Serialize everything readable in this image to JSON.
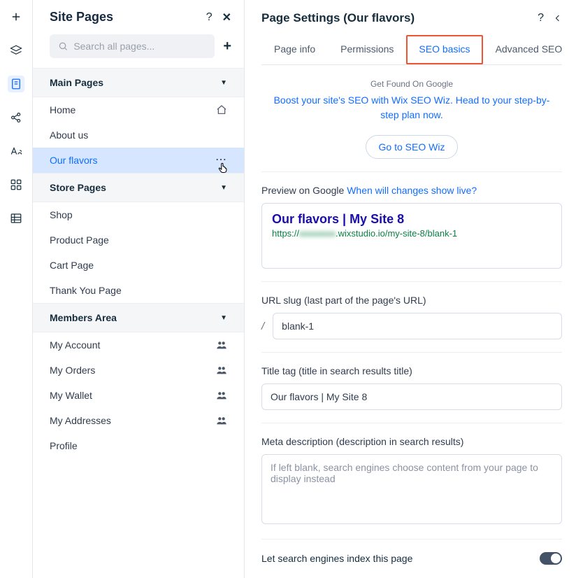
{
  "rail": {
    "items": [
      "plus",
      "layers",
      "page",
      "share",
      "font",
      "grid",
      "table"
    ],
    "active_index": 2
  },
  "pagesPanel": {
    "title": "Site Pages",
    "search_placeholder": "Search all pages...",
    "sections": [
      {
        "label": "Main Pages",
        "items": [
          {
            "label": "Home",
            "icon": "home"
          },
          {
            "label": "About us"
          },
          {
            "label": "Our flavors",
            "active": true,
            "icon": "more"
          }
        ]
      },
      {
        "label": "Store Pages",
        "items": [
          {
            "label": "Shop"
          },
          {
            "label": "Product Page"
          },
          {
            "label": "Cart Page"
          },
          {
            "label": "Thank You Page"
          }
        ]
      },
      {
        "label": "Members Area",
        "items": [
          {
            "label": "My Account",
            "icon": "members"
          },
          {
            "label": "My Orders",
            "icon": "members"
          },
          {
            "label": "My Wallet",
            "icon": "members"
          },
          {
            "label": "My Addresses",
            "icon": "members"
          },
          {
            "label": "Profile"
          }
        ]
      }
    ]
  },
  "settings": {
    "title": "Page Settings (Our flavors)",
    "tabs": [
      "Page info",
      "Permissions",
      "SEO basics",
      "Advanced SEO"
    ],
    "active_tab_index": 2,
    "seo": {
      "found_label": "Get Found On Google",
      "lead": "Boost your site's SEO with Wix SEO Wiz. Head to your step-by-step plan now.",
      "cta": "Go to SEO Wiz",
      "preview_label": "Preview on Google",
      "preview_link": "When will changes show live?",
      "google_title": "Our flavors | My Site 8",
      "google_url_prefix": "https://",
      "google_url_blur": "xxxxxxxx",
      "google_url_suffix": ".wixstudio.io/my-site-8/blank-1",
      "slug_label": "URL slug (last part of the page's URL)",
      "slug_value": "blank-1",
      "slash": "/",
      "title_tag_label": "Title tag (title in search results title)",
      "title_tag_value": "Our flavors | My Site 8",
      "meta_label": "Meta description (description in search results)",
      "meta_placeholder": "If left blank, search engines choose content from your page to display instead",
      "meta_value": "",
      "index_label": "Let search engines index this page",
      "index_on": true
    }
  }
}
